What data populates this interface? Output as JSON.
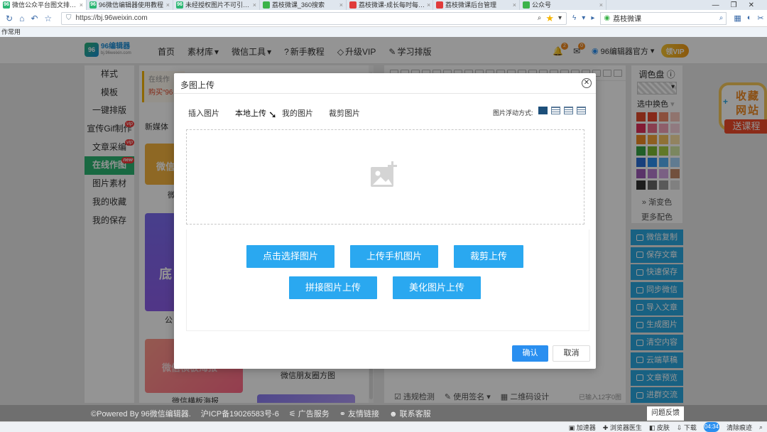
{
  "browser": {
    "tabs": [
      {
        "label": "微信公众平台图文排…",
        "fav": "96",
        "fav_color": "#2bb673",
        "active": true
      },
      {
        "label": "96微信编辑器使用教程",
        "fav": "96",
        "fav_color": "#2bb673",
        "active": false
      },
      {
        "label": "未经授权图片不可引…",
        "fav": "96",
        "fav_color": "#2bb673",
        "active": false
      },
      {
        "label": "荔枝微课_360搜索",
        "fav": "",
        "fav_color": "#3cb34a",
        "active": false
      },
      {
        "label": "荔枝微课-成长每时每…",
        "fav": "",
        "fav_color": "#e03b3b",
        "active": false
      },
      {
        "label": "荔枝微课后台管理",
        "fav": "",
        "fav_color": "#e03b3b",
        "active": false
      },
      {
        "label": "公众号",
        "fav": "",
        "fav_color": "#3cb34a",
        "active": false
      }
    ],
    "url": "https://bj.96weixin.com",
    "search_text": "荔枝微课",
    "favorites_label": "作常用"
  },
  "header": {
    "logo_mark": "96",
    "logo_name": "96编辑器",
    "logo_sub": "bj.96weixin.com",
    "nav": [
      {
        "label": "首页",
        "caret": ""
      },
      {
        "label": "素材库",
        "caret": "▾"
      },
      {
        "label": "微信工具",
        "caret": "▾"
      },
      {
        "label": "新手教程",
        "caret": ""
      },
      {
        "label": "升级VIP",
        "caret": ""
      },
      {
        "label": "学习排版",
        "caret": ""
      }
    ],
    "bell_count": "2",
    "mail_count": "0",
    "account": "96编辑器官方",
    "vip_label": "领VIP"
  },
  "sidebar": {
    "items": [
      {
        "label": "样式",
        "tag": ""
      },
      {
        "label": "模板",
        "tag": ""
      },
      {
        "label": "一键排版",
        "tag": ""
      },
      {
        "label": "宣传Gif制作",
        "tag": "vip"
      },
      {
        "label": "文章采编",
        "tag": "vip"
      },
      {
        "label": "在线作图",
        "tag": "new"
      },
      {
        "label": "图片素材",
        "tag": ""
      },
      {
        "label": "我的收藏",
        "tag": ""
      },
      {
        "label": "我的保存",
        "tag": ""
      }
    ]
  },
  "templates": {
    "notice_line1": "在线作",
    "notice_line2": "购买“96",
    "tab": "新媒体",
    "card_labels": [
      "微",
      "公",
      "微信横板海报",
      "微信朋友圈方图"
    ],
    "card_texts": [
      "微信",
      "底",
      "微信横板海报"
    ]
  },
  "editor": {
    "footer": [
      "违规检测",
      "使用签名 ▾",
      "二维码设计"
    ],
    "count": "已输入12字0图"
  },
  "colors": {
    "title": "调色盘",
    "select_label": "选中换色",
    "swatches": [
      "#e24a2c",
      "#e8472e",
      "#f08a6a",
      "#f8c9bd",
      "#e0305a",
      "#ec6d8a",
      "#f4a3b7",
      "#f9d2dd",
      "#f08a24",
      "#f5a43a",
      "#f7c35e",
      "#fbe2a6",
      "#37a345",
      "#7ab833",
      "#a8cf45",
      "#d5e9a6",
      "#2a6fd6",
      "#2a8ff0",
      "#55b0f5",
      "#a6d4fa",
      "#9b59b6",
      "#b57ccf",
      "#d2a6e3",
      "#c48a6a",
      "#333333",
      "#666666",
      "#999999",
      "#dddddd"
    ],
    "gradient_label": "渐变色",
    "more_label": "更多配色"
  },
  "actions": [
    "微信复制",
    "保存文章",
    "快速保存",
    "同步微信",
    "导入文章",
    "生成图片",
    "清空内容",
    "云端草稿",
    "文章预览",
    "进群交流"
  ],
  "float_badge": {
    "line1": "收藏",
    "line2": "网站",
    "ribbon": "送课程"
  },
  "modal": {
    "title": "多图上传",
    "tabs": [
      "插入图片",
      "本地上传",
      "我的图片",
      "裁剪图片"
    ],
    "active_tab": 1,
    "float_label": "图片浮动方式:",
    "buttons_row1": [
      "点击选择图片",
      "上传手机图片",
      "裁剪上传"
    ],
    "buttons_row2": [
      "拼接图片上传",
      "美化图片上传"
    ],
    "ok": "确认",
    "cancel": "取消"
  },
  "footer": {
    "items": [
      "©Powered By 96微信编辑器.",
      "沪ICP备19026583号-6",
      "广告服务",
      "友情链接",
      "联系客服"
    ],
    "feedback": "问题反馈"
  },
  "statusbar": {
    "items": [
      "加速器",
      "浏览器医生",
      "皮肤",
      "下载"
    ],
    "clock": "04:34",
    "clear": "清除痕迹"
  }
}
